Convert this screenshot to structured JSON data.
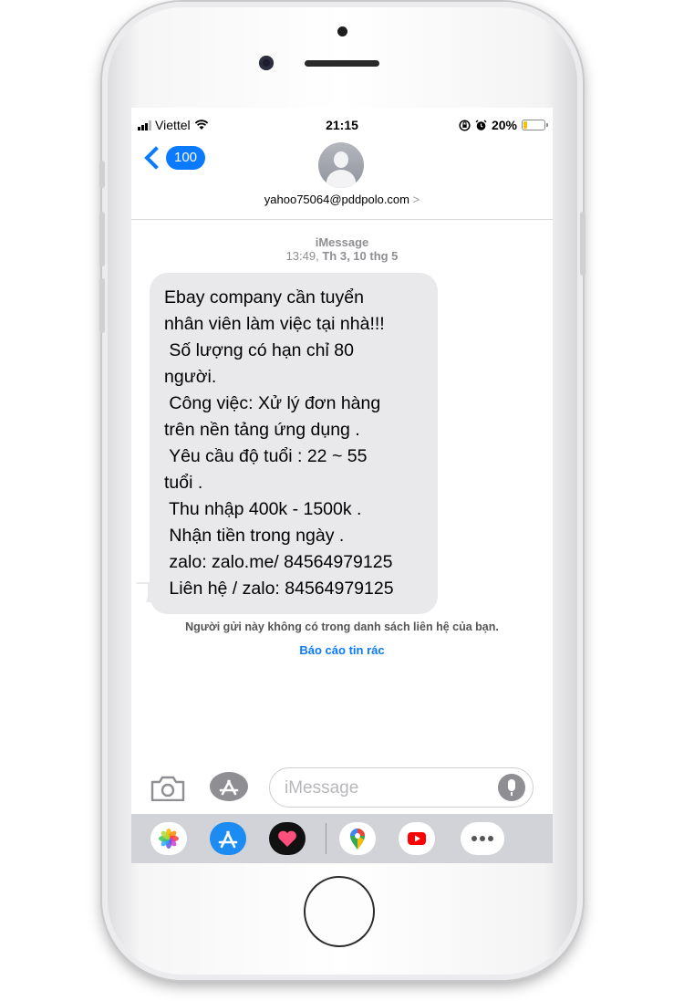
{
  "status_bar": {
    "carrier": "Viettel",
    "time": "21:15",
    "battery": "20%",
    "battery_level": 0.2
  },
  "nav": {
    "back_count": "100",
    "contact": "yahoo75064@pddpolo.com",
    "contact_arrow": ">"
  },
  "thread": {
    "service": "iMessage",
    "timestamp_time": "13:49,",
    "timestamp_date": "Th 3, 10 thg 5",
    "message_lines": [
      "Ebay company cần tuyển",
      "nhân viên làm việc tại nhà!!!",
      " Số lượng có hạn chỉ 80",
      "người.",
      " Công việc: Xử lý đơn hàng",
      "trên nền tảng ứng dụng .",
      " Yêu cầu độ tuổi : 22 ~ 55",
      "tuổi .",
      " Thu nhập 400k - 1500k .",
      " Nhận tiền trong ngày .",
      " zalo: zalo.me/ 84564979125",
      " Liên hệ / zalo: 84564979125"
    ],
    "unknown_sender_notice": "Người gửi này không có trong danh sách liên hệ của bạn.",
    "report_junk": "Báo cáo tin rác"
  },
  "composer": {
    "placeholder": "iMessage"
  },
  "app_drawer": {
    "apps": [
      "photos-icon",
      "app-store-icon",
      "digital-touch-icon",
      "google-maps-icon",
      "youtube-icon",
      "more-icon"
    ]
  },
  "colors": {
    "accent": "#0a7aff",
    "bubble": "#e9e9eb",
    "battery_fill": "#f4c20d"
  }
}
